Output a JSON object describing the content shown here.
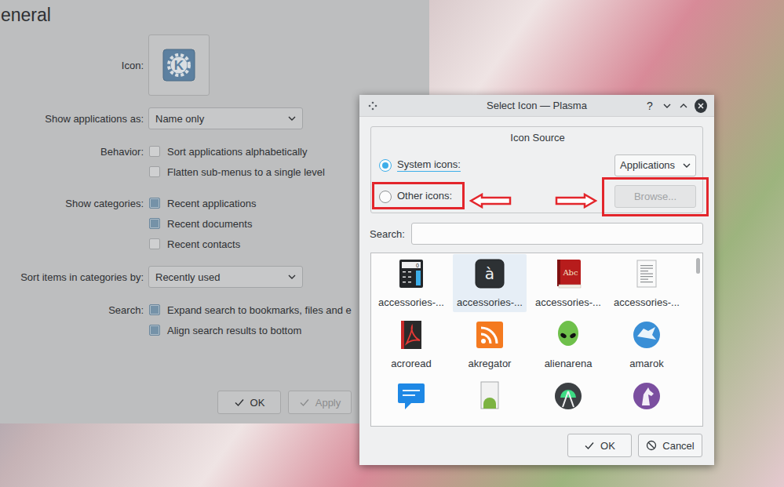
{
  "settings": {
    "title": "eneral",
    "icon": {
      "label": "Icon:",
      "glyph": "K"
    },
    "groups": [
      {
        "label": "Show applications as:",
        "items": [
          {
            "kind": "select",
            "text": "Name only",
            "checked": false
          }
        ]
      },
      {
        "label": "Behavior:",
        "items": [
          {
            "kind": "checkbox",
            "text": "Sort applications alphabetically",
            "checked": false
          },
          {
            "kind": "checkbox",
            "text": "Flatten sub-menus to a single level",
            "checked": false
          }
        ]
      },
      {
        "label": "Show categories:",
        "items": [
          {
            "kind": "checkbox",
            "text": "Recent applications",
            "checked": true
          },
          {
            "kind": "checkbox",
            "text": "Recent documents",
            "checked": true
          },
          {
            "kind": "checkbox",
            "text": "Recent contacts",
            "checked": false
          }
        ]
      },
      {
        "label": "Sort items in categories by:",
        "items": [
          {
            "kind": "select",
            "text": "Recently used",
            "checked": false
          }
        ]
      },
      {
        "label": "Search:",
        "items": [
          {
            "kind": "checkbox",
            "text": "Expand search to bookmarks, files and e",
            "checked": true
          },
          {
            "kind": "checkbox",
            "text": "Align search results to bottom",
            "checked": true
          }
        ]
      }
    ],
    "buttons": [
      {
        "label": "OK",
        "disabled": false
      },
      {
        "label": "Apply",
        "disabled": true
      }
    ]
  },
  "dialog": {
    "title": "Select Icon — Plasma",
    "title_buttons": [
      {
        "kind": "help",
        "glyph": "?"
      },
      {
        "kind": "minimize",
        "glyph": ""
      },
      {
        "kind": "maximize",
        "glyph": ""
      },
      {
        "kind": "close",
        "glyph": ""
      }
    ],
    "icon_source": {
      "title": "Icon Source",
      "options": [
        {
          "label": "System icons:",
          "selected": true,
          "kind": "select",
          "value": "Applications",
          "disabled": false
        },
        {
          "label": "Other icons:",
          "selected": false,
          "kind": "button",
          "value": "Browse...",
          "disabled": true
        }
      ]
    },
    "search": {
      "label": "Search:",
      "value": ""
    },
    "icons": [
      {
        "kind": "calculator",
        "label": "accessories-...",
        "glyph": "0",
        "selected": false
      },
      {
        "kind": "character",
        "label": "accessories-...",
        "glyph": "à",
        "selected": true
      },
      {
        "kind": "dictionary",
        "label": "accessories-...",
        "glyph": "Abc",
        "selected": false
      },
      {
        "kind": "text-editor",
        "label": "accessories-...",
        "glyph": "",
        "selected": false
      },
      {
        "kind": "acroread",
        "label": "acroread",
        "glyph": "",
        "selected": false
      },
      {
        "kind": "rss",
        "label": "akregator",
        "glyph": "",
        "selected": false
      },
      {
        "kind": "alien",
        "label": "alienarena",
        "glyph": "",
        "selected": false
      },
      {
        "kind": "amarok",
        "label": "amarok",
        "glyph": "",
        "selected": false
      },
      {
        "kind": "chat",
        "label": "",
        "glyph": "",
        "selected": false
      },
      {
        "kind": "android",
        "label": "",
        "glyph": "",
        "selected": false
      },
      {
        "kind": "android-studio",
        "label": "",
        "glyph": "",
        "selected": false
      },
      {
        "kind": "horse",
        "label": "",
        "glyph": "",
        "selected": false
      }
    ],
    "buttons": [
      {
        "label": "OK",
        "kind": "ok"
      },
      {
        "label": "Cancel",
        "kind": "cancel"
      }
    ]
  }
}
